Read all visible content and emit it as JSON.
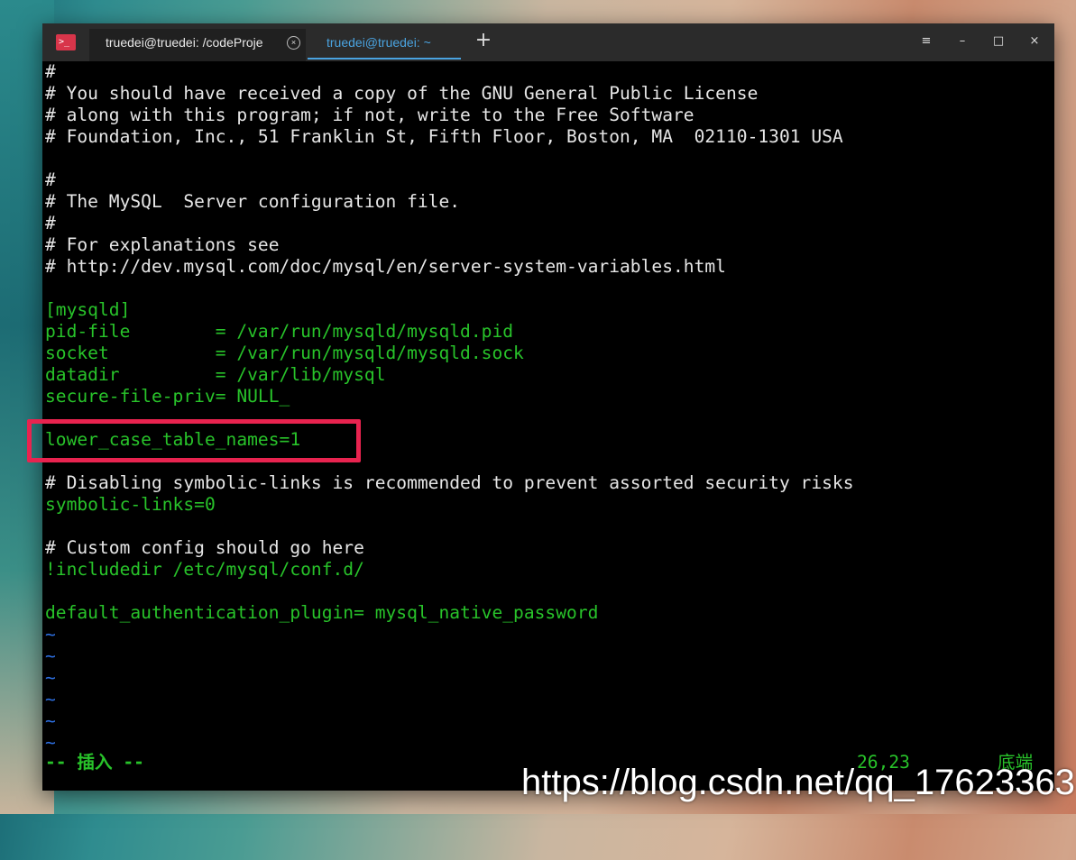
{
  "window": {
    "tabs": [
      {
        "label": "truedei@truedei: /codeProje",
        "active": false
      },
      {
        "label": "truedei@truedei: ~",
        "active": true
      }
    ],
    "app_icon": ">_",
    "new_tab_icon": "+",
    "menu_icon": "≡",
    "minimize_icon": "–",
    "maximize_icon": "□",
    "close_icon": "×",
    "tab_close_icon": "×"
  },
  "terminal": {
    "lines": [
      {
        "text": "#",
        "color": "white"
      },
      {
        "text": "# You should have received a copy of the GNU General Public License",
        "color": "white"
      },
      {
        "text": "# along with this program; if not, write to the Free Software",
        "color": "white"
      },
      {
        "text": "# Foundation, Inc., 51 Franklin St, Fifth Floor, Boston, MA  02110-1301 USA",
        "color": "white"
      },
      {
        "text": "",
        "color": "white"
      },
      {
        "text": "#",
        "color": "white"
      },
      {
        "text": "# The MySQL  Server configuration file.",
        "color": "white"
      },
      {
        "text": "#",
        "color": "white"
      },
      {
        "text": "# For explanations see",
        "color": "white"
      },
      {
        "text": "# http://dev.mysql.com/doc/mysql/en/server-system-variables.html",
        "color": "white"
      },
      {
        "text": "",
        "color": "white"
      },
      {
        "text": "[mysqld]",
        "color": "green"
      },
      {
        "text": "pid-file        = /var/run/mysqld/mysqld.pid",
        "color": "green"
      },
      {
        "text": "socket          = /var/run/mysqld/mysqld.sock",
        "color": "green"
      },
      {
        "text": "datadir         = /var/lib/mysql",
        "color": "green"
      },
      {
        "text": "secure-file-priv= NULL_",
        "color": "green"
      },
      {
        "text": "",
        "color": "white"
      },
      {
        "text": "lower_case_table_names=1",
        "color": "green"
      },
      {
        "text": "",
        "color": "white"
      },
      {
        "text": "# Disabling symbolic-links is recommended to prevent assorted security risks",
        "color": "white"
      },
      {
        "text": "symbolic-links=0",
        "color": "green"
      },
      {
        "text": "",
        "color": "white"
      },
      {
        "text": "# Custom config should go here",
        "color": "white"
      },
      {
        "text": "!includedir /etc/mysql/conf.d/",
        "color": "green"
      },
      {
        "text": "",
        "color": "white"
      },
      {
        "text": "default_authentication_plugin= mysql_native_password",
        "color": "green"
      },
      {
        "text": "~",
        "color": "tilde"
      },
      {
        "text": "~",
        "color": "tilde"
      },
      {
        "text": "~",
        "color": "tilde"
      },
      {
        "text": "~",
        "color": "tilde"
      },
      {
        "text": "~",
        "color": "tilde"
      },
      {
        "text": "~",
        "color": "tilde"
      }
    ],
    "status": {
      "mode": "-- 插入 --",
      "position": "26,23",
      "where": "底端"
    }
  },
  "watermark": "https://blog.csdn.net/qq_17623363",
  "colors": {
    "green": "#28c32a",
    "tilde": "#2d6fe0",
    "highlight": "#e8234f",
    "active_tab": "#4aa3e0"
  }
}
